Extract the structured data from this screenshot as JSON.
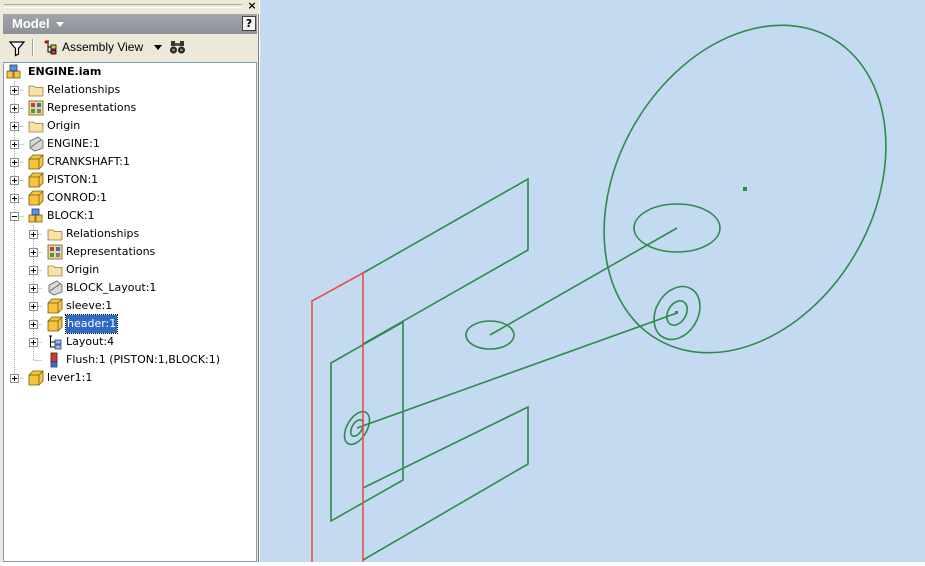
{
  "panel": {
    "title": "Model",
    "help_glyph": "?",
    "close_glyph": "×",
    "view_mode": "Assembly View"
  },
  "tree": {
    "root": "ENGINE.iam",
    "items": [
      {
        "label": "Relationships",
        "icon": "folder-icon"
      },
      {
        "label": "Representations",
        "icon": "representations-icon"
      },
      {
        "label": "Origin",
        "icon": "folder-icon"
      },
      {
        "label": "ENGINE:1",
        "icon": "sketch-part-icon"
      },
      {
        "label": "CRANKSHAFT:1",
        "icon": "part-icon"
      },
      {
        "label": "PISTON:1",
        "icon": "part-icon"
      },
      {
        "label": "CONROD:1",
        "icon": "part-icon"
      },
      {
        "label": "BLOCK:1",
        "icon": "subassembly-icon"
      },
      {
        "label": "lever1:1",
        "icon": "part-icon"
      }
    ],
    "block_children": [
      {
        "label": "Relationships",
        "icon": "folder-icon"
      },
      {
        "label": "Representations",
        "icon": "representations-icon"
      },
      {
        "label": "Origin",
        "icon": "folder-icon"
      },
      {
        "label": "BLOCK_Layout:1",
        "icon": "sketch-part-icon"
      },
      {
        "label": "sleeve:1",
        "icon": "part-icon"
      },
      {
        "label": "header:1",
        "icon": "part-icon",
        "selected": true
      },
      {
        "label": "Layout:4",
        "icon": "layout-icon"
      },
      {
        "label": "Flush:1 (PISTON:1,BLOCK:1)",
        "icon": "flush-constraint-icon"
      }
    ]
  },
  "viewport": {
    "background": "#c4daf1",
    "sketch_color": "#2e8b4a",
    "highlight_color": "#e8524a"
  }
}
